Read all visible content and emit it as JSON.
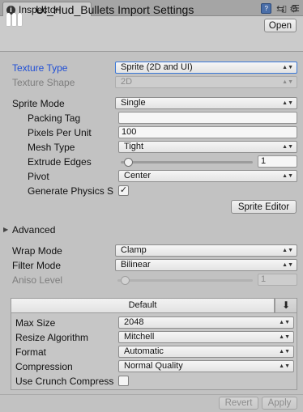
{
  "tab": {
    "title": "Inspector",
    "icon": "i"
  },
  "header": {
    "title": "UI_Hud_Bullets Import Settings",
    "open_label": "Open"
  },
  "texture": {
    "type_label": "Texture Type",
    "type_value": "Sprite (2D and UI)",
    "shape_label": "Texture Shape",
    "shape_value": "2D"
  },
  "sprite": {
    "mode_label": "Sprite Mode",
    "mode_value": "Single",
    "packing_tag_label": "Packing Tag",
    "packing_tag_value": "",
    "ppu_label": "Pixels Per Unit",
    "ppu_value": "100",
    "mesh_type_label": "Mesh Type",
    "mesh_type_value": "Tight",
    "extrude_label": "Extrude Edges",
    "extrude_value": "1",
    "extrude_fraction": 0.03,
    "pivot_label": "Pivot",
    "pivot_value": "Center",
    "physics_label": "Generate Physics S",
    "physics_checked": "✓",
    "editor_label": "Sprite Editor"
  },
  "advanced": {
    "label": "Advanced",
    "arrow": "▶"
  },
  "wrap": {
    "label": "Wrap Mode",
    "value": "Clamp"
  },
  "filter": {
    "label": "Filter Mode",
    "value": "Bilinear"
  },
  "aniso": {
    "label": "Aniso Level",
    "value": "1",
    "fraction": 0.0
  },
  "platform": {
    "tab_label": "Default",
    "max_size_label": "Max Size",
    "max_size_value": "2048",
    "resize_label": "Resize Algorithm",
    "resize_value": "Mitchell",
    "format_label": "Format",
    "format_value": "Automatic",
    "compression_label": "Compression",
    "compression_value": "Normal Quality",
    "crunch_label": "Use Crunch Compress",
    "crunch_checked": ""
  },
  "footer": {
    "revert_label": "Revert",
    "apply_label": "Apply"
  },
  "dropdown_arrow": "▲▼"
}
